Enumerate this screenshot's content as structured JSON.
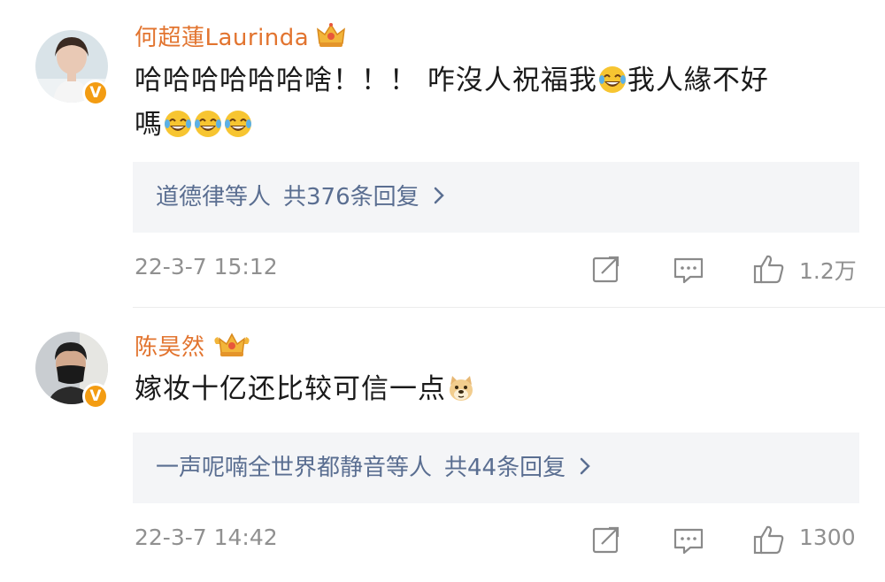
{
  "comments": [
    {
      "username": "何超蓮Laurinda",
      "content_text": "哈哈哈哈哈哈啥！！！ 咋沒人祝福我",
      "content_text_2": "我人緣不好",
      "content_text_3": "嗎",
      "verified_badge": "V",
      "reply_names": "道德律等人",
      "reply_count_text": "共376条回复",
      "time": "22-3-7 15:12",
      "like_count": "1.2万",
      "icons": [
        "avatar",
        "crown-badge-icon",
        "laugh-cry-emoji",
        "share-icon",
        "comment-icon",
        "like-icon",
        "chevron-right-icon"
      ]
    },
    {
      "username": "陈昊然",
      "content_text": "嫁妆十亿还比较可信一点",
      "verified_badge": "V",
      "reply_names": "一声呢喃全世界都静音等人",
      "reply_count_text": "共44条回复",
      "time": "22-3-7 14:42",
      "like_count": "1300",
      "icons": [
        "avatar",
        "crown-badge-icon",
        "doge-emoji",
        "share-icon",
        "comment-icon",
        "like-icon",
        "chevron-right-icon"
      ]
    }
  ],
  "colors": {
    "username": "#e2742f",
    "reply_link": "#5a6e91",
    "reply_bg": "#f4f5f7",
    "meta_text": "#909090",
    "badge": "#f39c12"
  }
}
